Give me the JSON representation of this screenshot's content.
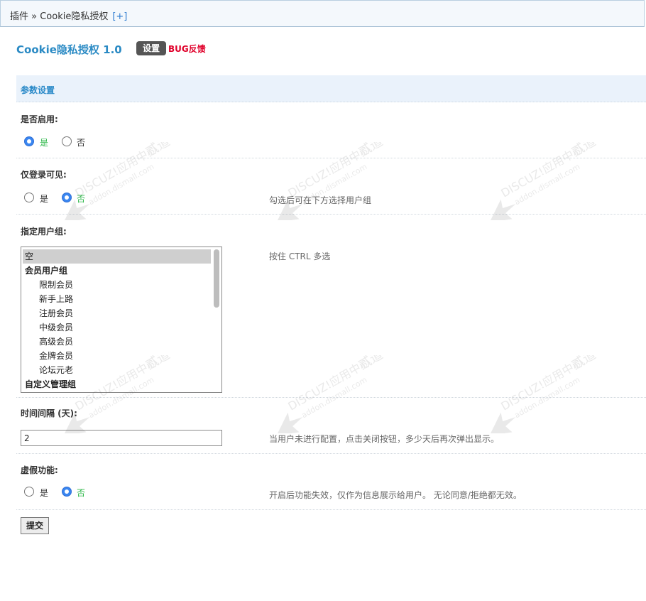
{
  "breadcrumb": {
    "path": "插件 » Cookie隐私授权",
    "expand": "[+]"
  },
  "plugin": {
    "title": "Cookie隐私授权 1.0",
    "setting_button": "设置",
    "bug_link": "BUG反馈"
  },
  "section": {
    "title": "参数设置"
  },
  "enable": {
    "label": "是否启用:",
    "options": [
      {
        "label": "是",
        "checked": true
      },
      {
        "label": "否",
        "checked": false
      }
    ]
  },
  "login_only": {
    "label": "仅登录可见:",
    "options": [
      {
        "label": "是",
        "checked": false
      },
      {
        "label": "否",
        "checked": true
      }
    ],
    "hint": "勾选后可在下方选择用户组"
  },
  "user_groups": {
    "label": "指定用户组:",
    "hint": "按住 CTRL 多选",
    "options": [
      {
        "label": "空",
        "kind": "sel"
      },
      {
        "label": "会员用户组",
        "kind": "grp"
      },
      {
        "label": "限制会员",
        "kind": "sub"
      },
      {
        "label": "新手上路",
        "kind": "sub"
      },
      {
        "label": "注册会员",
        "kind": "sub"
      },
      {
        "label": "中级会员",
        "kind": "sub"
      },
      {
        "label": "高级会员",
        "kind": "sub"
      },
      {
        "label": "金牌会员",
        "kind": "sub"
      },
      {
        "label": "论坛元老",
        "kind": "sub"
      },
      {
        "label": "自定义管理组",
        "kind": "grp"
      }
    ]
  },
  "interval": {
    "label": "时间间隔 (天):",
    "value": "2",
    "hint": "当用户未进行配置，点击关闭按钮，多少天后再次弹出显示。"
  },
  "fake_mode": {
    "label": "虚假功能:",
    "options": [
      {
        "label": "是",
        "checked": false
      },
      {
        "label": "否",
        "checked": true
      }
    ],
    "hint": "开启后功能失效，仅作为信息展示给用户。 无论同意/拒绝都无效。"
  },
  "submit_label": "提交",
  "watermark": {
    "text1": "DISCUZ!应用中心",
    "text2": "addon.dismall.com",
    "text3": "贰道"
  }
}
